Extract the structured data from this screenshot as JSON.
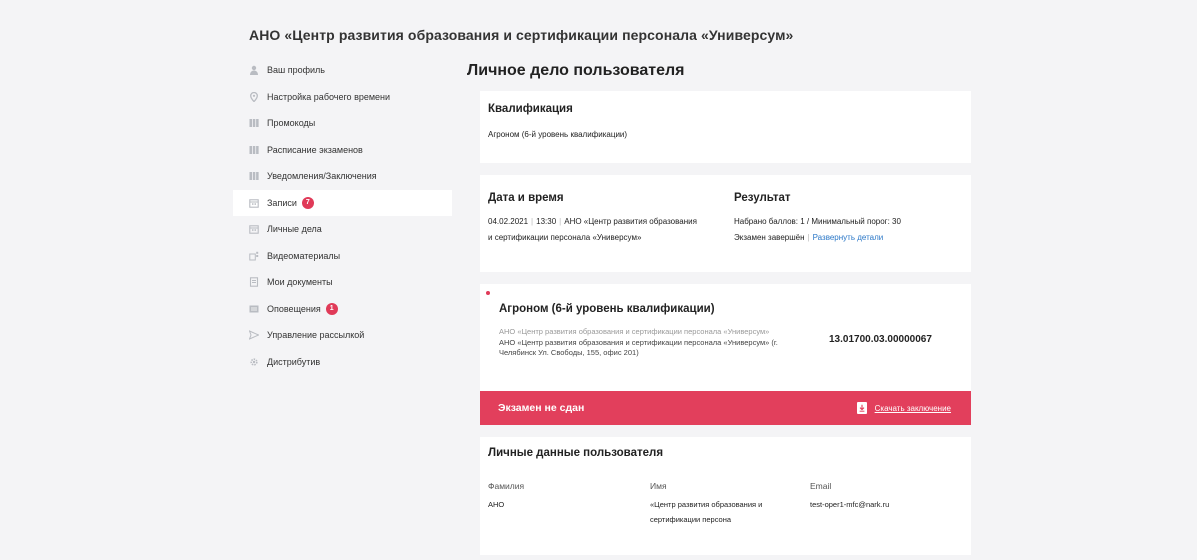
{
  "org_title": "АНО «Центр развития образования и сертификации персонала «Универсум»",
  "sidebar": {
    "items": [
      {
        "label": "Ваш профиль",
        "icon": "user-icon"
      },
      {
        "label": "Настройка рабочего времени",
        "icon": "location-pin-icon"
      },
      {
        "label": "Промокоды",
        "icon": "grid-icon"
      },
      {
        "label": "Расписание экзаменов",
        "icon": "grid-icon"
      },
      {
        "label": "Уведомления/Заключения",
        "icon": "grid-icon"
      },
      {
        "label": "Записи",
        "icon": "calendar-icon",
        "badge": "7"
      },
      {
        "label": "Личные дела",
        "icon": "calendar-icon"
      },
      {
        "label": "Видеоматериалы",
        "icon": "video-icon"
      },
      {
        "label": "Мои документы",
        "icon": "document-icon"
      },
      {
        "label": "Оповещения",
        "icon": "notifications-icon",
        "badge": "1"
      },
      {
        "label": "Управление рассылкой",
        "icon": "send-icon"
      },
      {
        "label": "Дистрибутив",
        "icon": "gear-icon"
      }
    ]
  },
  "page_title": "Личное дело пользователя",
  "qualification": {
    "heading": "Квалификация",
    "value": "Агроном (6-й уровень квалификации)"
  },
  "datetime": {
    "heading": "Дата и время",
    "date": "04.02.2021",
    "time": "13:30",
    "org_line1": "АНО «Центр развития образования",
    "org_line2": "и сертификации персонала «Универсум»"
  },
  "result": {
    "heading": "Результат",
    "score_text": "Набрано баллов: 1 / Минимальный порог: 30",
    "status_text": "Экзамен завершён",
    "details_link": "Развернуть детали"
  },
  "exam": {
    "title": "Агроном (6-й уровень квалификации)",
    "org_a": "АНО «Центр развития образования и сертификации персонала «Универсум»",
    "org_b": "АНО «Центр развития образования и сертификации персонала «Универсум» (г. Челябинск Ул. Свободы, 155, офис 201)",
    "code": "13.01700.03.00000067",
    "status": "Экзамен не сдан",
    "download_label": "Скачать заключение"
  },
  "personal": {
    "heading": "Личные данные пользователя",
    "surname_label": "Фамилия",
    "surname_value": "АНО",
    "name_label": "Имя",
    "name_value_1": "«Центр развития образования и",
    "name_value_2": "сертификации персона",
    "email_label": "Email",
    "email_value": "test-oper1-mfc@nark.ru"
  },
  "colors": {
    "accent_red": "#e23f5c",
    "link_blue": "#2a77c7",
    "background": "#f4f4f6"
  }
}
